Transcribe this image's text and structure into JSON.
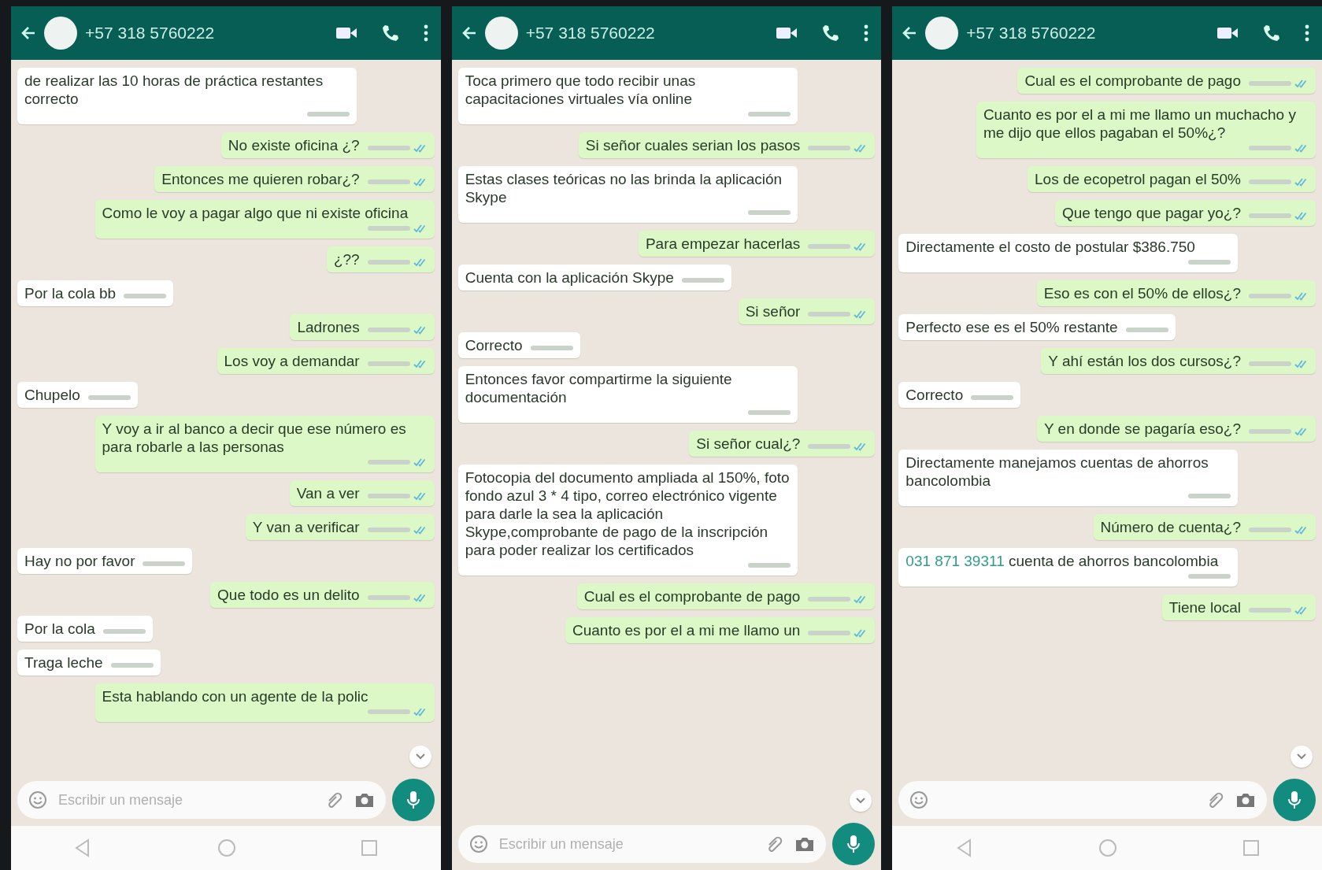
{
  "panels": [
    {
      "contact": "+57 318 5760222",
      "nav_bar": true,
      "composer": {
        "placeholder": "Escribir un mensaje"
      },
      "messages": [
        {
          "kind": "received",
          "text": "de realizar las 10 horas de práctica restantes correcto"
        },
        {
          "kind": "sent",
          "text": "No existe oficina ¿?"
        },
        {
          "kind": "sent",
          "text": "Entonces me quieren robar¿?"
        },
        {
          "kind": "sent",
          "text": "Como le voy a pagar algo que ni existe oficina"
        },
        {
          "kind": "sent",
          "text": "¿??"
        },
        {
          "kind": "received",
          "text": "Por la cola bb"
        },
        {
          "kind": "sent",
          "text": "Ladrones"
        },
        {
          "kind": "sent",
          "text": "Los voy a demandar"
        },
        {
          "kind": "received",
          "text": "Chupelo"
        },
        {
          "kind": "sent",
          "text": "Y voy a ir al banco a decir que ese número es para robarle  a las personas"
        },
        {
          "kind": "sent",
          "text": "Van a ver"
        },
        {
          "kind": "sent",
          "text": "Y van a verificar"
        },
        {
          "kind": "received",
          "text": "Hay no por favor"
        },
        {
          "kind": "sent",
          "text": "Que todo es un delito"
        },
        {
          "kind": "received",
          "text": "Por la cola"
        },
        {
          "kind": "received",
          "text": "Traga leche"
        },
        {
          "kind": "sent",
          "text": "Esta hablando con un agente de la polic"
        }
      ]
    },
    {
      "contact": "+57 318 5760222",
      "nav_bar": false,
      "composer": {
        "placeholder": "Escribir un mensaje"
      },
      "messages": [
        {
          "kind": "received",
          "text": "Toca primero que todo recibir unas capacitaciones virtuales vía online"
        },
        {
          "kind": "sent",
          "text": "Si señor cuales serian los pasos"
        },
        {
          "kind": "received",
          "text": "Estas clases teóricas no las brinda la aplicación Skype"
        },
        {
          "kind": "sent",
          "text": "Para empezar hacerlas"
        },
        {
          "kind": "received",
          "text": "Cuenta con la aplicación Skype"
        },
        {
          "kind": "sent",
          "text": "Si señor"
        },
        {
          "kind": "received",
          "text": "Correcto"
        },
        {
          "kind": "received",
          "text": "Entonces favor compartirme la siguiente documentación"
        },
        {
          "kind": "sent",
          "text": "Si señor cual¿?"
        },
        {
          "kind": "received",
          "text": "Fotocopia del documento ampliada al 150%, foto fondo azul 3 * 4 tipo, correo electrónico vigente para darle la sea la aplicación Skype,comprobante de pago de la inscripción para poder realizar los certificados"
        },
        {
          "kind": "sent",
          "text": "Cual es el comprobante de pago"
        },
        {
          "kind": "sent",
          "text": "Cuanto es por el a mi me llamo un"
        }
      ]
    },
    {
      "contact": "+57 318 5760222",
      "nav_bar": true,
      "messages": [
        {
          "kind": "sent",
          "text": "Cual es el comprobante de pago"
        },
        {
          "kind": "sent",
          "text": "Cuanto es por el a mi me llamo un muchacho y me dijo que ellos pagaban el 50%¿?"
        },
        {
          "kind": "sent",
          "text": "Los de ecopetrol pagan el 50%"
        },
        {
          "kind": "sent",
          "text": "Que tengo que pagar yo¿?"
        },
        {
          "kind": "received",
          "text": "Directamente el costo de postular $386.750"
        },
        {
          "kind": "sent",
          "text": "Eso es con el 50% de ellos¿?"
        },
        {
          "kind": "received",
          "text": "Perfecto ese es el 50% restante"
        },
        {
          "kind": "sent",
          "text": "Y ahí están los dos cursos¿?"
        },
        {
          "kind": "received",
          "text": "Correcto"
        },
        {
          "kind": "sent",
          "text": "Y en donde se pagaría eso¿?"
        },
        {
          "kind": "received",
          "text": "Directamente manejamos cuentas de ahorros bancolombia"
        },
        {
          "kind": "sent",
          "text": "Número de cuenta¿?"
        },
        {
          "kind": "received",
          "link": "031 871 39311",
          "text": "cuenta de ahorros bancolombia"
        },
        {
          "kind": "sent",
          "text": "Tiene local"
        }
      ]
    }
  ]
}
